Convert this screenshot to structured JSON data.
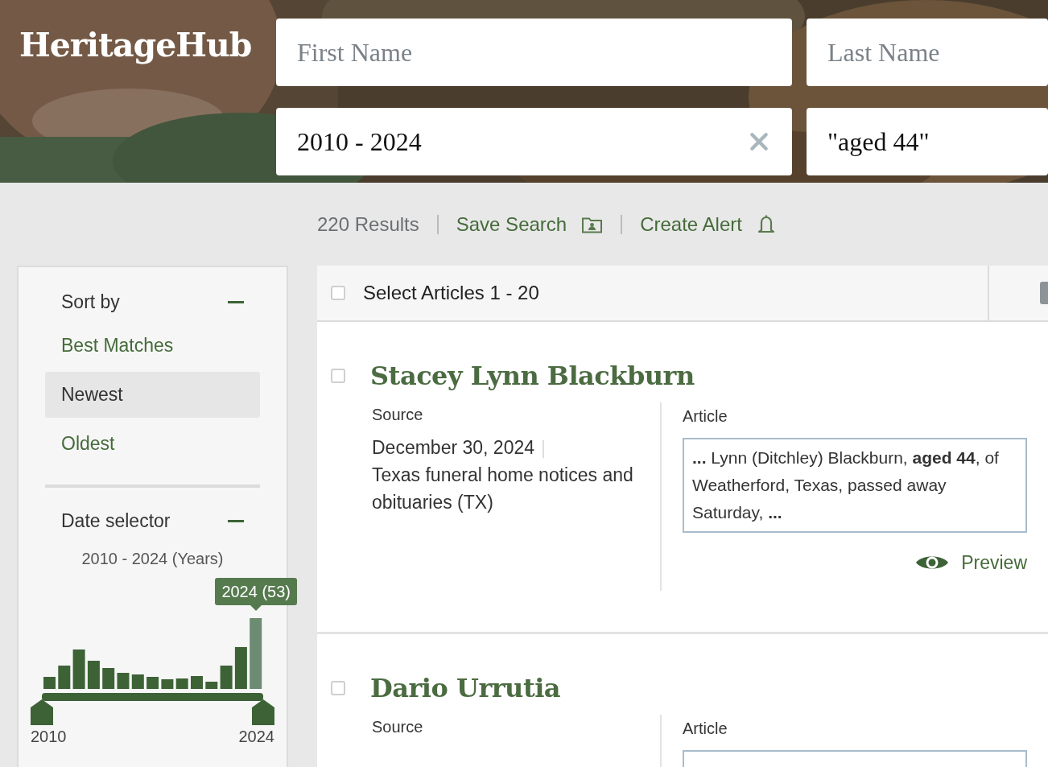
{
  "header": {
    "logo": "HeritageHub",
    "fields": [
      {
        "placeholder": "First Name",
        "clearable": false
      },
      {
        "placeholder": "Last Name",
        "clearable": false
      },
      {
        "value": "2010 - 2024",
        "clearable": true
      },
      {
        "value": "\"aged 44\"",
        "clearable": false
      }
    ]
  },
  "toolbar": {
    "count": "220 Results",
    "links": [
      {
        "label": "Save Search",
        "kind": "save"
      },
      {
        "label": "Create Alert",
        "kind": "alert"
      }
    ]
  },
  "sidebar": {
    "sort": {
      "title": "Sort by",
      "expanded": true,
      "options": [
        {
          "label": "Best Matches",
          "selected": false
        },
        {
          "label": "Newest",
          "selected": true
        },
        {
          "label": "Oldest",
          "selected": false
        }
      ]
    },
    "date": {
      "title": "Date selector",
      "expanded": true,
      "range": "2010 - 2024 (Years)",
      "tooltip": "2024 (53)",
      "min_label": "2010",
      "max_label": "2024"
    }
  },
  "results": {
    "select_all": {
      "label": "Select Articles 1 - 20",
      "checked": false
    },
    "items": [
      {
        "title": "Stacey Lynn Blackburn",
        "checked": false,
        "source_label": "Source",
        "date": "December 30, 2024",
        "source": "Texas funeral home notices and obituaries (TX)",
        "article_label": "Article",
        "snippet": "**...** Lynn (Ditchley) Blackburn, **aged 44**, of Weatherford, Texas, passed away Saturday, **...**",
        "preview": "Preview"
      },
      {
        "title": "Dario Urrutia",
        "checked": false,
        "source_label": "Source",
        "article_label": "Article"
      }
    ]
  }
}
